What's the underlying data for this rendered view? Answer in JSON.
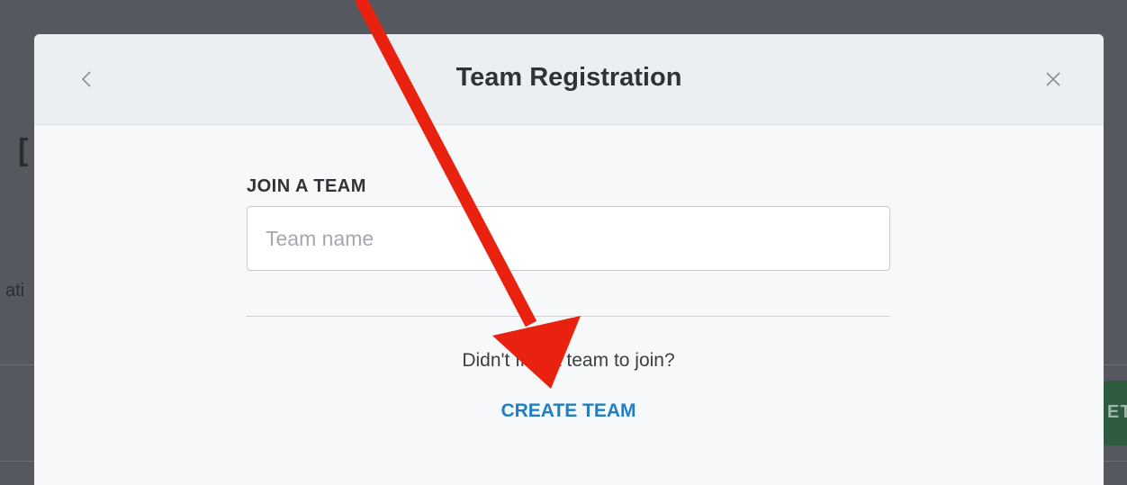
{
  "modal": {
    "title": "Team Registration",
    "back_icon": "chevron-left-icon",
    "close_icon": "close-icon"
  },
  "form": {
    "join_label": "JOIN A TEAM",
    "team_name_placeholder": "Team name",
    "team_name_value": "",
    "prompt_text": "Didn't find a team to join?",
    "create_team_label": "CREATE TEAM"
  },
  "colors": {
    "accent_link": "#1f7fc2",
    "annotation_arrow": "#e8220f",
    "backdrop": "#55585e"
  }
}
